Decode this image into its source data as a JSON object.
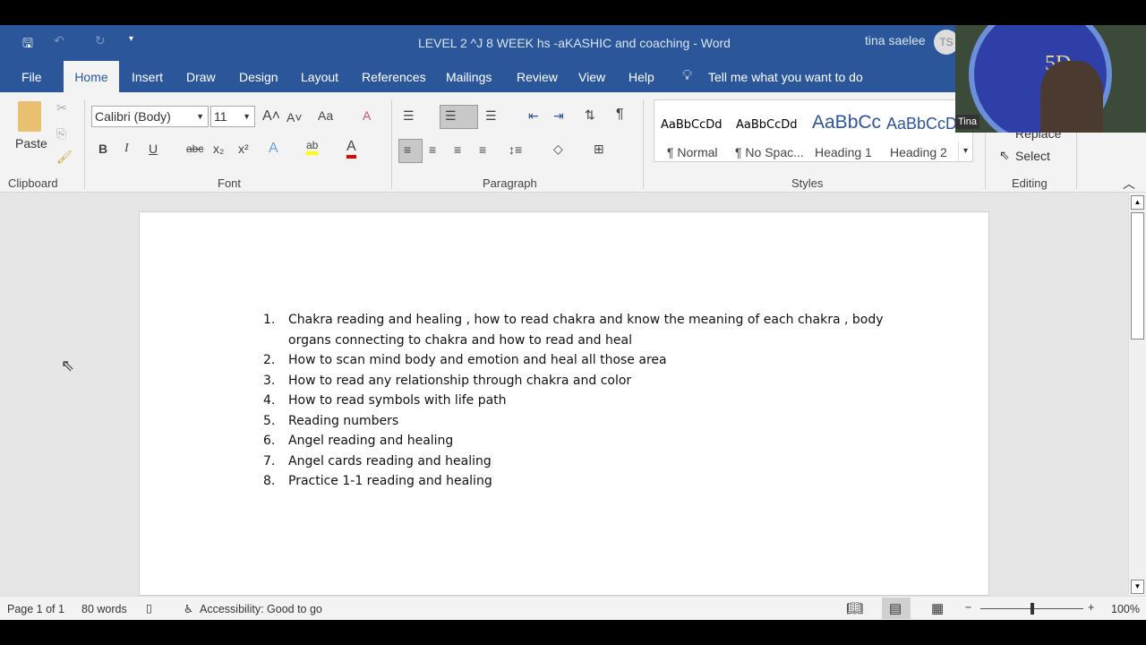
{
  "title_bar": {
    "title": "LEVEL 2 ^J  8 WEEK hs -aKASHIC and coaching  -  Word",
    "user": "tina saelee",
    "avatar_initials": "TS"
  },
  "tabs": [
    {
      "label": "File"
    },
    {
      "label": "Home"
    },
    {
      "label": "Insert"
    },
    {
      "label": "Draw"
    },
    {
      "label": "Design"
    },
    {
      "label": "Layout"
    },
    {
      "label": "References"
    },
    {
      "label": "Mailings"
    },
    {
      "label": "Review"
    },
    {
      "label": "View"
    },
    {
      "label": "Help"
    }
  ],
  "tell_me": "Tell me what you want to do",
  "ribbon": {
    "clipboard": {
      "paste": "Paste",
      "group": "Clipboard"
    },
    "font": {
      "name": "Calibri (Body)",
      "size": "11",
      "change_case": "Aa",
      "bold": "B",
      "italic": "I",
      "underline": "U",
      "strike": "abc",
      "sub": "x₂",
      "sup": "x²",
      "group": "Font",
      "highlight_color": "#ffff00",
      "font_color": "#e00000"
    },
    "paragraph": {
      "group": "Paragraph"
    },
    "styles": {
      "items": [
        {
          "preview": "AaBbCcDd",
          "name": "¶ Normal"
        },
        {
          "preview": "AaBbCcDd",
          "name": "¶ No Spac..."
        },
        {
          "preview": "AaBbCc",
          "name": "Heading 1"
        },
        {
          "preview": "AaBbCcD",
          "name": "Heading 2"
        }
      ],
      "group": "Styles"
    },
    "editing": {
      "replace": "Replace",
      "select": "Select",
      "group": "Editing"
    }
  },
  "webcam": {
    "name": "Tina",
    "badge_text": "5D"
  },
  "document": {
    "list": [
      {
        "n": "1.",
        "lines": [
          "Chakra reading and healing , how to read chakra and know the meaning of each chakra , body",
          "organs connecting to chakra and how to read and heal"
        ]
      },
      {
        "n": "2.",
        "lines": [
          "How to scan mind body and emotion and heal all those area"
        ]
      },
      {
        "n": "3.",
        "lines": [
          "How to read any relationship through chakra and color"
        ]
      },
      {
        "n": "4.",
        "lines": [
          "How to read symbols with life path"
        ]
      },
      {
        "n": "5.",
        "lines": [
          "Reading numbers"
        ]
      },
      {
        "n": "6.",
        "lines": [
          "Angel reading and healing"
        ]
      },
      {
        "n": "7.",
        "lines": [
          "Angel cards reading and healing"
        ]
      },
      {
        "n": "8.",
        "lines": [
          "Practice 1-1 reading and healing"
        ]
      }
    ]
  },
  "status": {
    "page": "Page 1 of 1",
    "words": "80 words",
    "accessibility": "Accessibility: Good to go",
    "zoom": "100%",
    "zoom_percent": 100
  },
  "colors": {
    "brand": "#2b579a"
  }
}
